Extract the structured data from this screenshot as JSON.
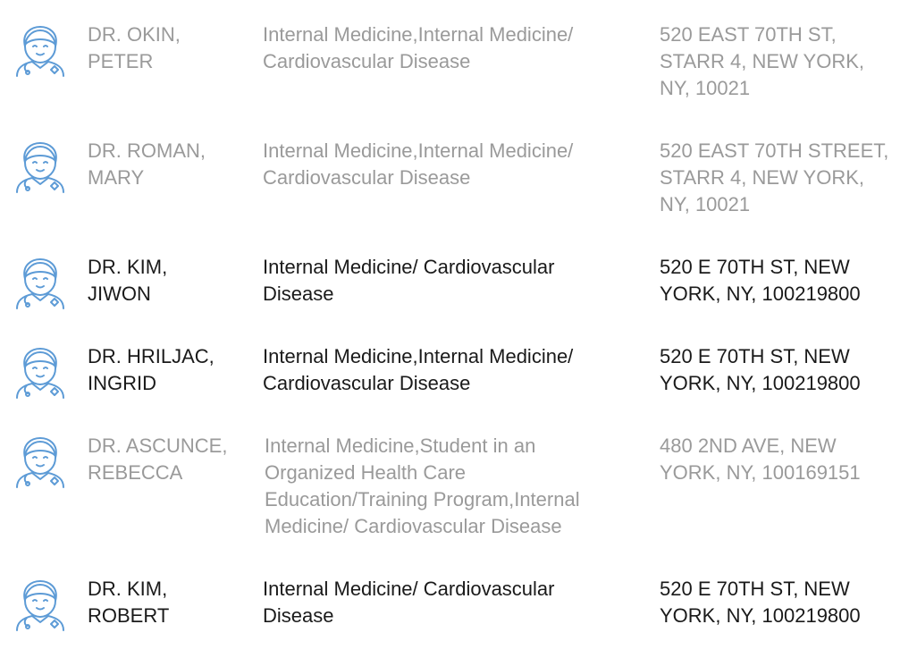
{
  "doctors": [
    {
      "name": "DR. OKIN,\nPETER",
      "specialty": "Internal Medicine,Internal Medicine/\nCardiovascular Disease",
      "address": "520 EAST 70TH ST,\nSTARR 4, NEW YORK,\nNY, 10021",
      "muted": true,
      "icon": "doctor-avatar-icon"
    },
    {
      "name": "DR. ROMAN,\nMARY",
      "specialty": "Internal Medicine,Internal Medicine/\nCardiovascular Disease",
      "address": "520 EAST 70TH STREET,\nSTARR 4, NEW YORK,\nNY, 10021",
      "muted": true,
      "icon": "doctor-avatar-icon"
    },
    {
      "name": "DR. KIM,\nJIWON",
      "specialty": "Internal Medicine/ Cardiovascular\nDisease",
      "address": "520 E 70TH ST, NEW\nYORK, NY, 100219800",
      "muted": false,
      "icon": "doctor-avatar-icon"
    },
    {
      "name": "DR. HRILJAC,\nINGRID",
      "specialty": "Internal Medicine,Internal Medicine/\nCardiovascular Disease",
      "address": "520 E 70TH ST, NEW\nYORK, NY, 100219800",
      "muted": false,
      "icon": "doctor-avatar-icon"
    },
    {
      "name": "DR. ASCUNCE,\nREBECCA",
      "specialty": "Internal Medicine,Student in an\nOrganized Health Care\nEducation/Training Program,Internal\nMedicine/ Cardiovascular Disease",
      "address": "480 2ND AVE, NEW\nYORK, NY, 100169151",
      "muted": true,
      "icon": "doctor-avatar-icon"
    },
    {
      "name": "DR. KIM,\nROBERT",
      "specialty": "Internal Medicine/ Cardiovascular\nDisease",
      "address": "520 E 70TH ST, NEW\nYORK, NY, 100219800",
      "muted": false,
      "icon": "doctor-avatar-icon"
    }
  ],
  "colors": {
    "text": "#1a1a1a",
    "muted_text": "#9a9a9a",
    "icon": "#5d9bd6"
  }
}
